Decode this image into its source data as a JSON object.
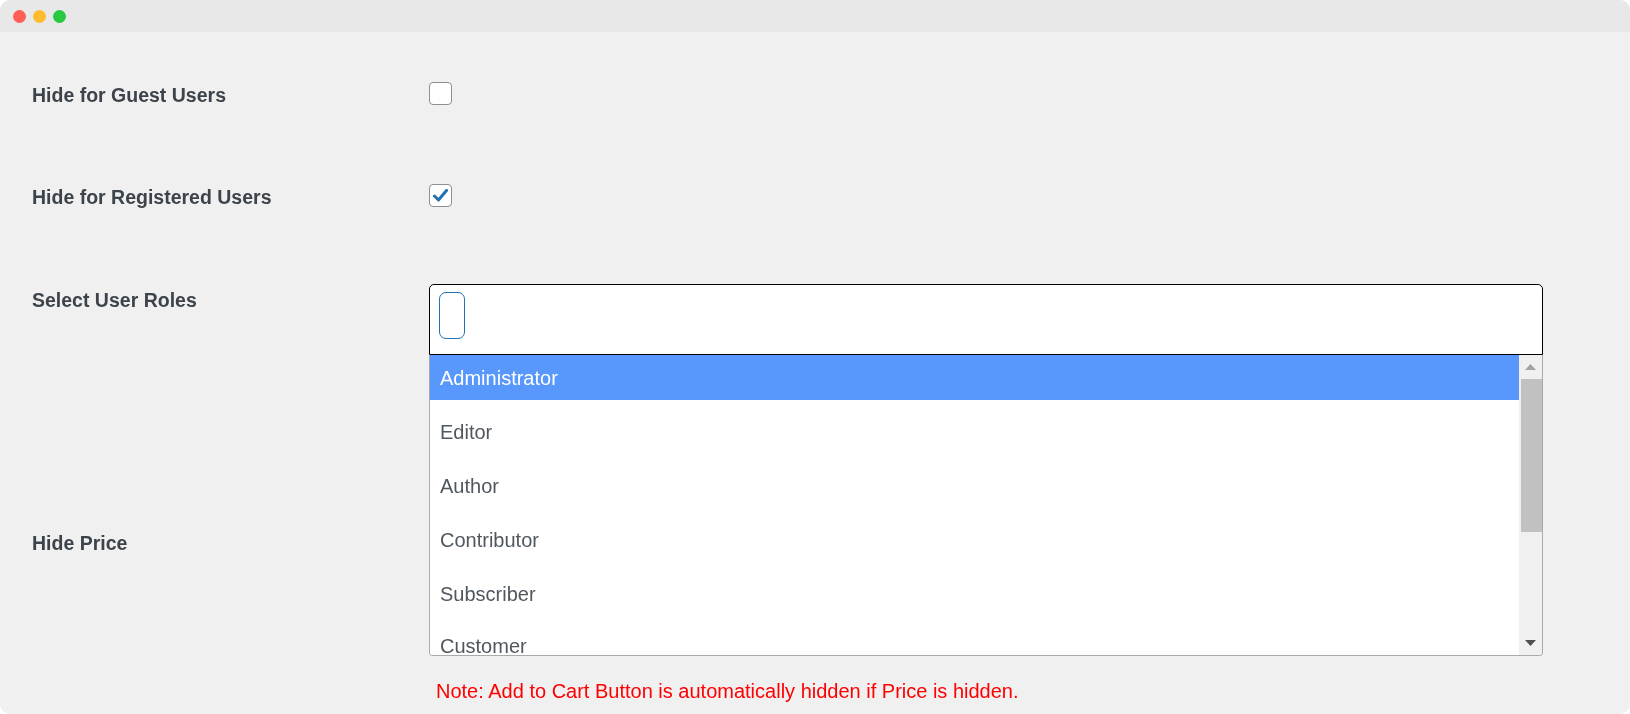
{
  "window": {
    "controls": [
      {
        "kind": "close"
      },
      {
        "kind": "minimize"
      },
      {
        "kind": "zoom"
      }
    ]
  },
  "settings": [
    {
      "kind": "checkbox",
      "label": "Hide for Guest Users",
      "checked": false
    },
    {
      "kind": "checkbox",
      "label": "Hide for Registered Users",
      "checked": true
    },
    {
      "kind": "multiselect",
      "label": "Select User Roles",
      "options": [
        {
          "label": "Administrator",
          "selected": true
        },
        {
          "label": "Editor",
          "selected": false
        },
        {
          "label": "Author",
          "selected": false
        },
        {
          "label": "Contributor",
          "selected": false
        },
        {
          "label": "Subscriber",
          "selected": false
        },
        {
          "label": "Customer",
          "selected": false
        }
      ]
    },
    {
      "kind": "note",
      "label": "Hide Price",
      "note": "Note: Add to Cart Button is automatically hidden if Price is hidden."
    }
  ]
}
